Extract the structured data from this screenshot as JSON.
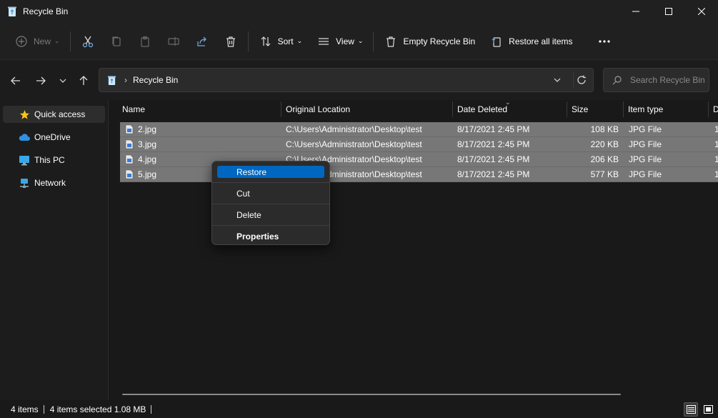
{
  "window": {
    "title": "Recycle Bin",
    "icon": "recycle-bin-icon",
    "controls": [
      "minimize-icon",
      "maximize-icon",
      "close-icon"
    ]
  },
  "toolbar": {
    "new_label": "New",
    "sort_label": "Sort",
    "view_label": "View",
    "empty_label": "Empty Recycle Bin",
    "restore_all_label": "Restore all items"
  },
  "address": {
    "path": "Recycle Bin"
  },
  "search": {
    "placeholder": "Search Recycle Bin"
  },
  "sidebar": {
    "items": [
      {
        "label": "Quick access",
        "icon": "star-icon"
      },
      {
        "label": "OneDrive",
        "icon": "cloud-icon"
      },
      {
        "label": "This PC",
        "icon": "monitor-icon"
      },
      {
        "label": "Network",
        "icon": "network-icon"
      }
    ]
  },
  "columns": {
    "name": "Name",
    "original_location": "Original Location",
    "date_deleted": "Date Deleted",
    "size": "Size",
    "item_type": "Item type",
    "extra": "D"
  },
  "files": [
    {
      "name": "2.jpg",
      "location": "C:\\Users\\Administrator\\Desktop\\test",
      "date": "8/17/2021 2:45 PM",
      "size": "108 KB",
      "type": "JPG File",
      "extra": "1"
    },
    {
      "name": "3.jpg",
      "location": "C:\\Users\\Administrator\\Desktop\\test",
      "date": "8/17/2021 2:45 PM",
      "size": "220 KB",
      "type": "JPG File",
      "extra": "1"
    },
    {
      "name": "4.jpg",
      "location": "C:\\Users\\Administrator\\Desktop\\test",
      "date": "8/17/2021 2:45 PM",
      "size": "206 KB",
      "type": "JPG File",
      "extra": "1"
    },
    {
      "name": "5.jpg",
      "location": "C:\\Users\\Administrator\\Desktop\\test",
      "date": "8/17/2021 2:45 PM",
      "size": "577 KB",
      "type": "JPG File",
      "extra": "1"
    }
  ],
  "context_menu": {
    "restore": "Restore",
    "cut": "Cut",
    "delete": "Delete",
    "properties": "Properties"
  },
  "status": {
    "count": "4 items",
    "selected": "4 items selected  1.08 MB"
  },
  "colors": {
    "selection": "#777777",
    "accent": "#0067c0",
    "background": "#191919"
  }
}
